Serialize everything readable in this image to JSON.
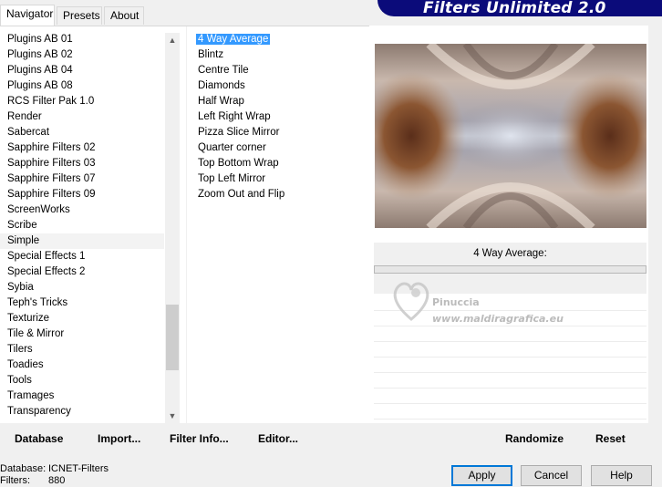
{
  "tabs": [
    {
      "label": "Navigator",
      "active": true
    },
    {
      "label": "Presets",
      "active": false
    },
    {
      "label": "About",
      "active": false
    }
  ],
  "banner": {
    "title": "Filters Unlimited 2.0",
    "color": "#0b0b7a"
  },
  "categories": {
    "items": [
      "Plugins AB 01",
      "Plugins AB 02",
      "Plugins AB 04",
      "Plugins AB 08",
      "RCS Filter Pak 1.0",
      "Render",
      "Sabercat",
      "Sapphire Filters 02",
      "Sapphire Filters 03",
      "Sapphire Filters 07",
      "Sapphire Filters 09",
      "ScreenWorks",
      "Scribe",
      "Simple",
      "Special Effects 1",
      "Special Effects 2",
      "Sybia",
      "Teph's Tricks",
      "Texturize",
      "Tile & Mirror",
      "Tilers",
      "Toadies",
      "Tools",
      "Tramages",
      "Transparency"
    ],
    "selected": "Simple"
  },
  "filters": {
    "items": [
      "4 Way Average",
      "Blintz",
      "Centre Tile",
      "Diamonds",
      "Half Wrap",
      "Left Right Wrap",
      "Pizza Slice Mirror",
      "Quarter corner",
      "Top Bottom Wrap",
      "Top Left Mirror",
      "Zoom Out and Flip"
    ],
    "selected": "4 Way Average",
    "selection_color": "#3399ff"
  },
  "preview": {
    "filter_name": "4 Way Average:"
  },
  "watermark": {
    "line1": "Pinuccia",
    "line2": "www.maldiragrafica.eu"
  },
  "toolbar": {
    "database": "Database",
    "import": "Import...",
    "filter_info": "Filter Info...",
    "editor": "Editor...",
    "randomize": "Randomize",
    "reset": "Reset"
  },
  "status": {
    "database_label": "Database:",
    "database_value": "ICNET-Filters",
    "filters_label": "Filters:",
    "filters_value": "880"
  },
  "dialog": {
    "apply": "Apply",
    "cancel": "Cancel",
    "help": "Help"
  }
}
